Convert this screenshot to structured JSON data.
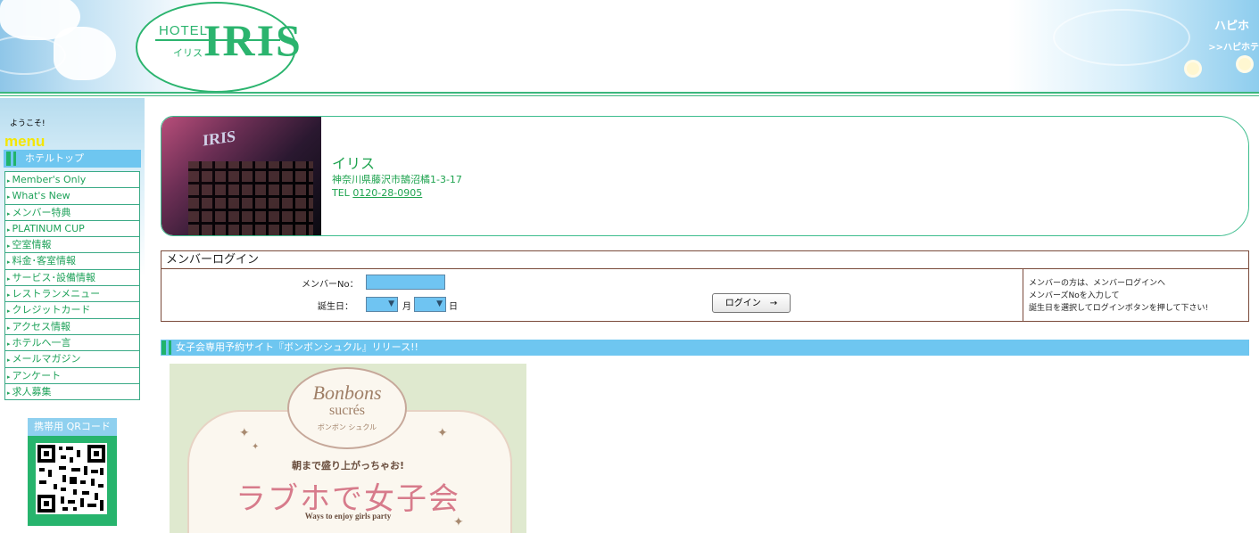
{
  "header": {
    "logo_hotel": "HOTEL",
    "logo_name": "IRIS",
    "logo_kana": "イリス",
    "partner_logo": "ハピホ",
    "partner_link": ">>ハピホテ"
  },
  "sidebar": {
    "welcome": "ようこそ!",
    "menu_label": "menu",
    "menu_header": "ホテルトップ",
    "items": [
      {
        "label": "Member's Only"
      },
      {
        "label": "What's New"
      },
      {
        "label": "メンバー特典"
      },
      {
        "label": "PLATINUM CUP"
      },
      {
        "label": "空室情報"
      },
      {
        "label": "料金･客室情報"
      },
      {
        "label": "サービス･設備情報"
      },
      {
        "label": "レストランメニュー"
      },
      {
        "label": "クレジットカード"
      },
      {
        "label": "アクセス情報"
      },
      {
        "label": "ホテルへ一言"
      },
      {
        "label": "メールマガジン"
      },
      {
        "label": "アンケート"
      },
      {
        "label": "求人募集"
      }
    ],
    "qr_title": "携帯用 QRコード"
  },
  "hotel": {
    "name": "イリス",
    "address": "神奈川県藤沢市鵠沼橘1-3-17",
    "tel_label": "TEL",
    "tel": "0120-28-0905"
  },
  "login": {
    "title": "メンバーログイン",
    "member_label": "メンバーNo：",
    "member_value": "",
    "birth_label": "誕生日：",
    "month_unit": "月",
    "day_unit": "日",
    "month_value": "",
    "day_value": "",
    "button": "ログイン　→",
    "help": [
      "メンバーの方は、メンバーログインへ",
      "メンバーズNoを入力して",
      "誕生日を選択してログインボタンを押して下さい!"
    ]
  },
  "news": {
    "title": "女子会専用予約サイト『ボンボンシュクル』リリース!!"
  },
  "banner": {
    "brand_line1": "Bonbons",
    "brand_line2": "sucrés",
    "brand_kana": "ボンボン シュクル",
    "tagline": "朝まで盛り上がっちゃお!",
    "headline": "ラブホで女子会",
    "subline": "Ways to enjoy girls party"
  },
  "colors": {
    "accent_green": "#2bb46e",
    "menu_blue": "#6ec6f0",
    "input_blue": "#6fc4f2",
    "login_border": "#7a4a3a",
    "banner_pink": "#d77b8b"
  }
}
